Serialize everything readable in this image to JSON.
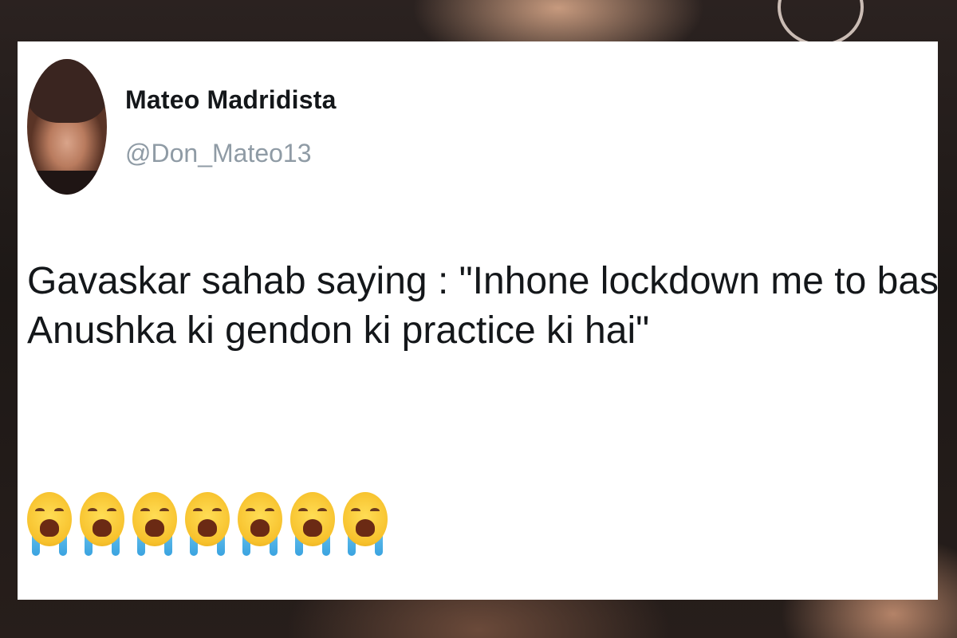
{
  "tweet": {
    "author_name": "Mateo Madridista",
    "author_handle": "@Don_Mateo13",
    "text_lines": [
      "Gavaskar sahab saying : \"Inhone lockdown me to bas",
      "Anushka ki gendon ki practice ki hai\""
    ],
    "emojis": [
      "crying-face-icon",
      "crying-face-icon",
      "crying-face-icon",
      "crying-face-icon",
      "crying-face-icon",
      "crying-face-icon",
      "crying-face-icon"
    ]
  },
  "colors": {
    "card_background": "#ffffff",
    "name_text": "#14171a",
    "handle_text": "#8f9ba5",
    "emoji_face": "#f7c12c",
    "emoji_tears": "#3aa3e0"
  }
}
